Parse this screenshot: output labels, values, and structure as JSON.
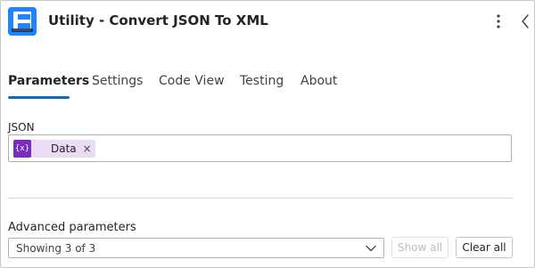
{
  "header": {
    "title": "Utility - Convert JSON To XML",
    "app_icon": "utility-app-icon",
    "accent_color": "#1f85ff",
    "more_icon": "more-vertical-icon",
    "collapse_icon": "chevron-left-icon"
  },
  "tabs": [
    {
      "label": "Parameters",
      "active": true
    },
    {
      "label": "Settings",
      "active": false
    },
    {
      "label": "Code View",
      "active": false
    },
    {
      "label": "Testing",
      "active": false
    },
    {
      "label": "About",
      "active": false
    }
  ],
  "tab_accent_color": "#0f6cbd",
  "json_field": {
    "label": "JSON",
    "token": {
      "icon_text": "{x}",
      "label": "Data",
      "remove_glyph": "×",
      "token_color": "#ebdcf5",
      "icon_color": "#7b2cbf"
    }
  },
  "advanced": {
    "label": "Advanced parameters",
    "select_value": "Showing 3 of 3",
    "show_all_label": "Show all",
    "show_all_disabled": true,
    "clear_all_label": "Clear all"
  }
}
